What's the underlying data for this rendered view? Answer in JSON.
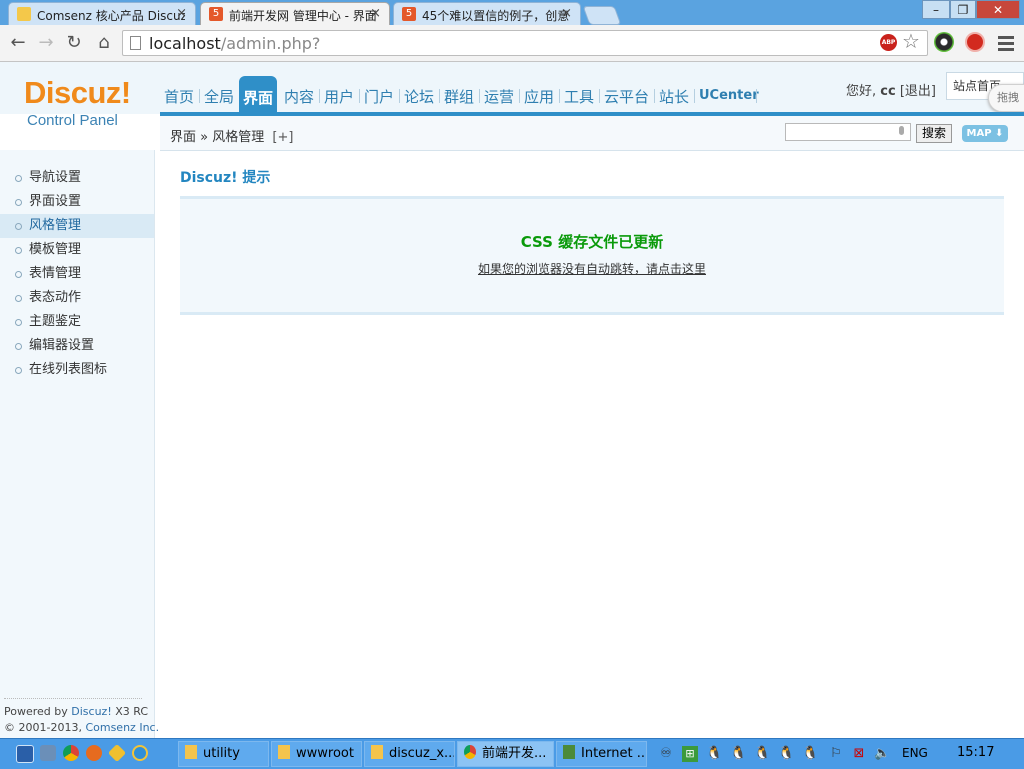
{
  "browser": {
    "tabs": [
      {
        "title": "Comsenz 核心产品 Discuz",
        "icon": "comsenz-favicon",
        "active": false
      },
      {
        "title": "前端开发网 管理中心 - 界面",
        "icon": "html5-favicon",
        "active": true
      },
      {
        "title": "45个难以置信的例子，创意",
        "icon": "html5-favicon",
        "active": false
      }
    ],
    "close_glyph": "×",
    "url_host": "localhost",
    "url_path": "/admin.php?",
    "abp_label": "ABP",
    "window_buttons": {
      "minimize": "–",
      "maximize": "❐",
      "close": "✕"
    }
  },
  "header": {
    "logo_text": "Discuz!",
    "logo_sub": "Control Panel",
    "nav": [
      "首页",
      "全局",
      "界面",
      "内容",
      "用户",
      "门户",
      "论坛",
      "群组",
      "运营",
      "应用",
      "工具",
      "云平台",
      "站长",
      "UCenter"
    ],
    "active_nav": "界面",
    "greeting": "您好,",
    "username": "cc",
    "logout": "[退出]",
    "site_index": "站点首页",
    "drag_tip": "拖拽"
  },
  "subbar": {
    "breadcrumb_section": "界面",
    "breadcrumb_sep": "»",
    "breadcrumb_page": "风格管理",
    "breadcrumb_plus": "[+]",
    "search_value": "",
    "search_button": "搜索",
    "map_button": "MAP ⬇"
  },
  "sidebar": {
    "items": [
      "导航设置",
      "界面设置",
      "风格管理",
      "模板管理",
      "表情管理",
      "表态动作",
      "主题鉴定",
      "编辑器设置",
      "在线列表图标"
    ],
    "active": "风格管理",
    "powered_prefix": "Powered by ",
    "powered_link": "Discuz!",
    "powered_version": " X3 RC",
    "copyright_prefix": "© 2001-2013, ",
    "copyright_link": "Comsenz Inc."
  },
  "main": {
    "title": "Discuz! 提示",
    "message": "CSS 缓存文件已更新",
    "redirect_link": "如果您的浏览器没有自动跳转，请点击这里"
  },
  "taskbar": {
    "buttons": [
      {
        "label": "utility",
        "icon": "folder-icon"
      },
      {
        "label": "wwwroot",
        "icon": "folder-icon"
      },
      {
        "label": "discuz_x...",
        "icon": "folder-icon"
      },
      {
        "label": "前端开发...",
        "icon": "chrome-icon",
        "active": true
      },
      {
        "label": "Internet ...",
        "icon": "ie-network-icon"
      }
    ],
    "language": "ENG",
    "time": "15:17"
  },
  "colors": {
    "accent_blue": "#2f8fc8",
    "logo_orange": "#f08a1b",
    "success_green": "#0a9a0a",
    "taskbar_blue": "#4a9be6"
  }
}
